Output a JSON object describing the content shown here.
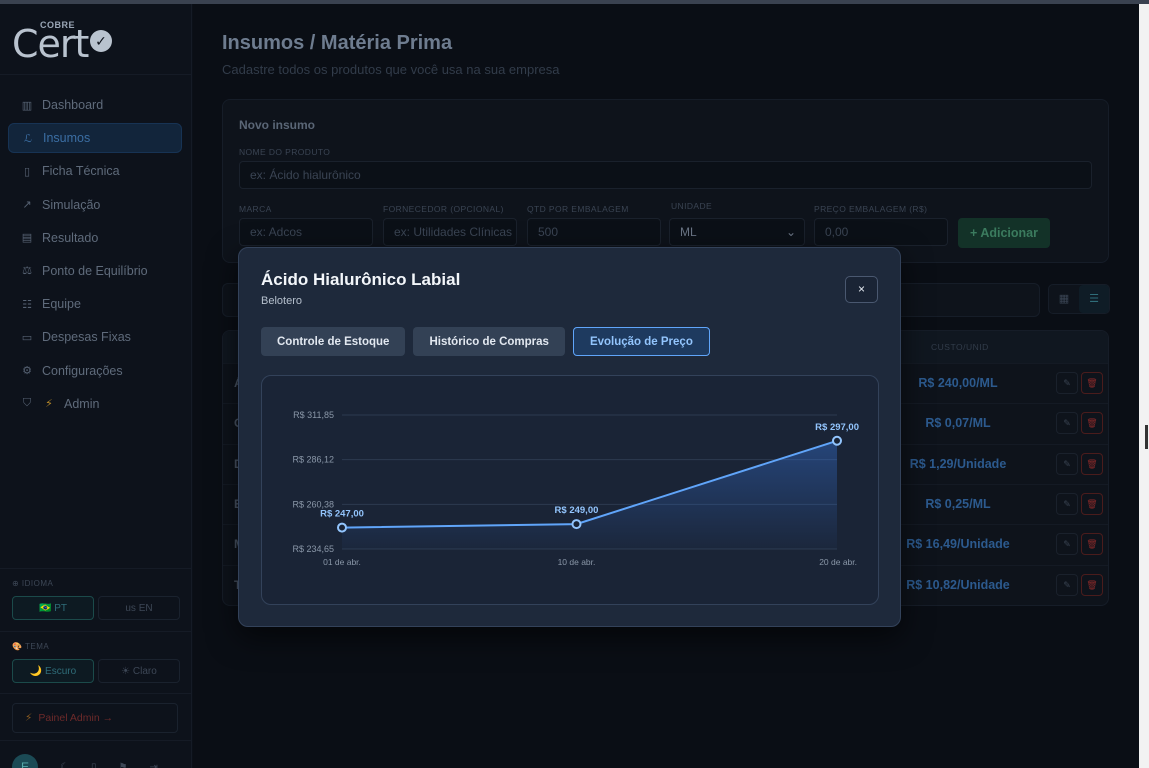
{
  "sidebar": {
    "logo_top": "COBRE",
    "logo_main": "Cert",
    "logo_check": "✓",
    "items": [
      {
        "icon": "bar-chart-icon",
        "glyph": "▥",
        "label": "Dashboard"
      },
      {
        "icon": "flask-icon",
        "glyph": "ℒ",
        "label": "Insumos"
      },
      {
        "icon": "clipboard-icon",
        "glyph": "▯",
        "label": "Ficha Técnica"
      },
      {
        "icon": "trend-icon",
        "glyph": "↗",
        "label": "Simulação"
      },
      {
        "icon": "document-icon",
        "glyph": "▤",
        "label": "Resultado"
      },
      {
        "icon": "scale-icon",
        "glyph": "⚖",
        "label": "Ponto de Equilíbrio"
      },
      {
        "icon": "team-icon",
        "glyph": "☷",
        "label": "Equipe"
      },
      {
        "icon": "wallet-icon",
        "glyph": "▭",
        "label": "Despesas Fixas"
      },
      {
        "icon": "gear-icon",
        "glyph": "⚙",
        "label": "Configurações"
      },
      {
        "icon": "shield-icon",
        "glyph": "⛉",
        "label": "Admin"
      }
    ],
    "admin_bolt": "⚡",
    "language_label": "⊕ IDIOMA",
    "lang_pt": "🇧🇷 PT",
    "lang_en": "us EN",
    "theme_label": "🎨 TEMA",
    "theme_dark": "🌙 Escuro",
    "theme_light": "☀ Claro",
    "admin_panel": "Painel Admin →",
    "admin_panel_bolt": "⚡",
    "avatar_letter": "E"
  },
  "main": {
    "title": "Insumos / Matéria Prima",
    "subtitle": "Cadastre todos os produtos que você usa na sua empresa",
    "new_card": {
      "title": "Novo insumo",
      "name_label": "NOME DO PRODUTO",
      "name_placeholder": "ex: Ácido hialurônico",
      "brand_label": "MARCA",
      "brand_placeholder": "ex: Adcos",
      "supplier_label": "FORNECEDOR (OPCIONAL)",
      "supplier_placeholder": "ex: Utilidades Clínicas",
      "qty_label": "QTD POR EMBALAGEM",
      "qty_value": "500",
      "unit_label": "UNIDADE",
      "unit_value": "ML",
      "price_label": "PREÇO EMBALAGEM (R$)",
      "price_placeholder": "0,00",
      "add_button": "+ Adicionar"
    },
    "table": {
      "cost_header": "CUSTO/UNID",
      "rows": [
        {
          "lead": "Á",
          "cost": "R$ 240,00/ML"
        },
        {
          "lead": "C",
          "cost": "R$ 0,07/ML"
        },
        {
          "lead": "D",
          "cost": "R$ 1,29/Unidade"
        },
        {
          "lead": "E",
          "cost": "R$ 0,25/ML"
        },
        {
          "lead": "M",
          "cost": "R$ 16,49/Unidade"
        },
        {
          "lead": "T",
          "cost": "R$ 10,82/Unidade"
        }
      ]
    }
  },
  "modal": {
    "title": "Ácido Hialurônico Labial",
    "subtitle": "Belotero",
    "close": "×",
    "tabs": [
      "Controle de Estoque",
      "Histórico de Compras",
      "Evolução de Preço"
    ],
    "active_tab": 2
  },
  "chart_data": {
    "type": "area",
    "x": [
      "01 de abr.",
      "10 de abr.",
      "20 de abr."
    ],
    "x_days": [
      1,
      10,
      20
    ],
    "values": [
      247.0,
      249.0,
      297.0
    ],
    "point_labels": [
      "R$ 247,00",
      "R$ 249,00",
      "R$ 297,00"
    ],
    "yticks": [
      234.65,
      260.38,
      286.12,
      311.85
    ],
    "ytick_labels": [
      "R$ 234,65",
      "R$ 260,38",
      "R$ 286,12",
      "R$ 311,85"
    ],
    "ylim": [
      234.65,
      311.85
    ],
    "grid": true,
    "line_color": "#60a5fa"
  }
}
